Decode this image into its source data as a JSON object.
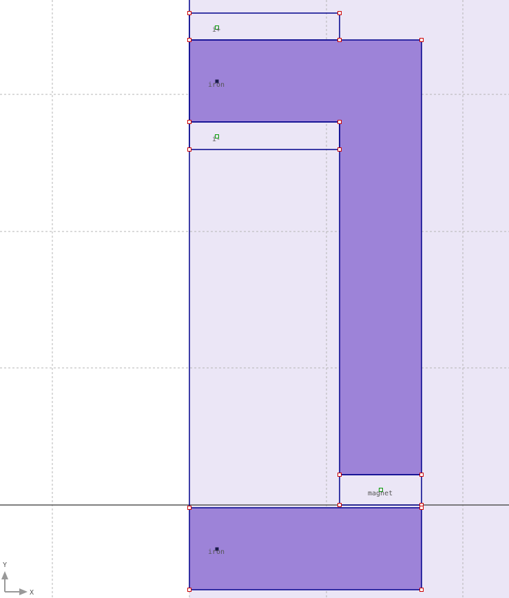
{
  "colors": {
    "background": "#ffffff",
    "air_region": "#ebe6f6",
    "material_fill": "#9d83d8",
    "segment_line": "#00008b",
    "grid_line": "#b4b4b4",
    "axis_line": "#555555",
    "node_stroke": "#cc0000",
    "label_marker_green": "#009900",
    "label_marker_dark": "#1a1a4a"
  },
  "labels": {
    "coil_top": "i+",
    "coil_bottom": "i-",
    "iron_top": "iron",
    "iron_bottom": "iron",
    "magnet": "magnet"
  },
  "axes": {
    "x": "X",
    "y": "Y"
  },
  "icons": {
    "origin": "xy-axis-indicator-icon",
    "material_marker": "block-label-marker-icon"
  }
}
